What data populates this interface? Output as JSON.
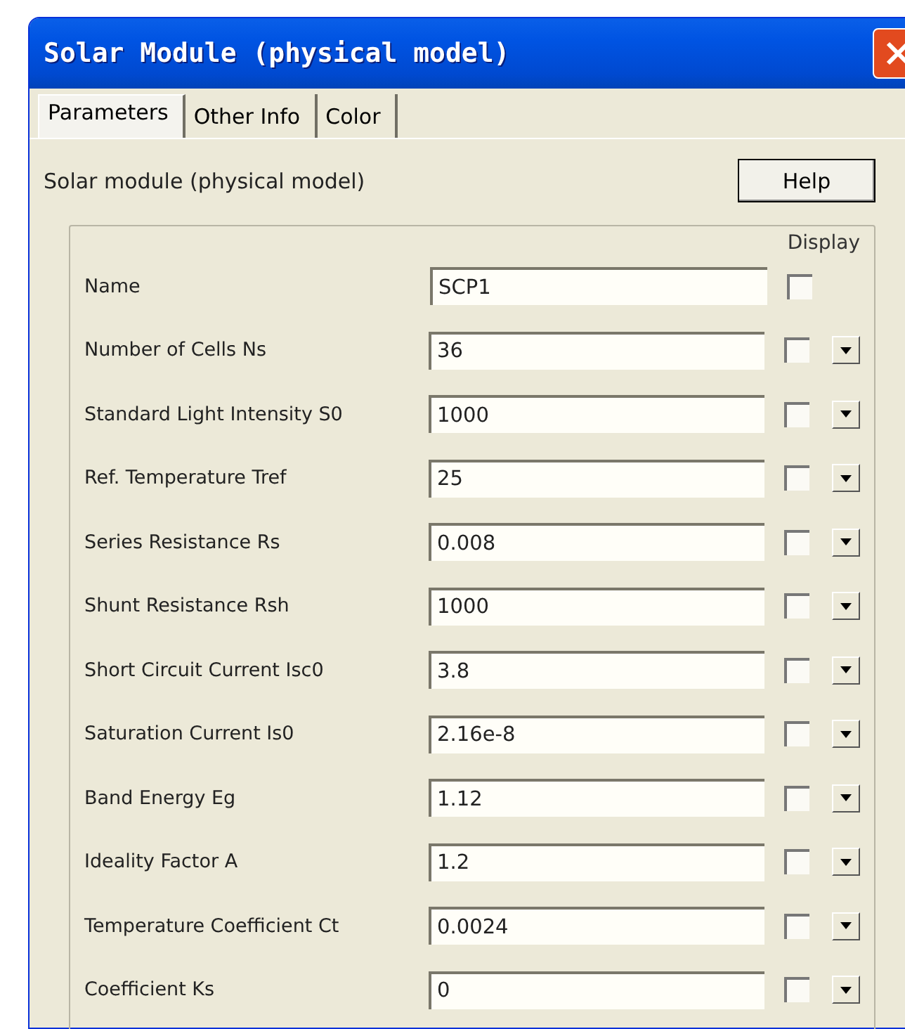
{
  "window": {
    "title": "Solar Module (physical model)"
  },
  "tabs": [
    {
      "label": "Parameters",
      "selected": true
    },
    {
      "label": "Other Info",
      "selected": false
    },
    {
      "label": "Color",
      "selected": false
    }
  ],
  "heading": "Solar module (physical model)",
  "help_button": "Help",
  "display_header": "Display",
  "params": [
    {
      "kind": "text",
      "label": "Name",
      "value": "SCP1",
      "checked": false
    },
    {
      "kind": "dropdown",
      "label": "Number of Cells Ns",
      "value": "36",
      "checked": false
    },
    {
      "kind": "dropdown",
      "label": "Standard Light Intensity S0",
      "value": "1000",
      "checked": false
    },
    {
      "kind": "dropdown",
      "label": "Ref. Temperature Tref",
      "value": "25",
      "checked": false
    },
    {
      "kind": "dropdown",
      "label": "Series Resistance Rs",
      "value": "0.008",
      "checked": false
    },
    {
      "kind": "dropdown",
      "label": "Shunt Resistance Rsh",
      "value": "1000",
      "checked": false
    },
    {
      "kind": "dropdown",
      "label": "Short Circuit Current Isc0",
      "value": "3.8",
      "checked": false
    },
    {
      "kind": "dropdown",
      "label": "Saturation Current Is0",
      "value": "2.16e-8",
      "checked": false
    },
    {
      "kind": "dropdown",
      "label": "Band Energy Eg",
      "value": "1.12",
      "checked": false
    },
    {
      "kind": "dropdown",
      "label": "Ideality Factor A",
      "value": "1.2",
      "checked": false
    },
    {
      "kind": "dropdown",
      "label": "Temperature Coefficient Ct",
      "value": "0.0024",
      "checked": false
    },
    {
      "kind": "dropdown",
      "label": "Coefficient Ks",
      "value": "0",
      "checked": false
    }
  ]
}
